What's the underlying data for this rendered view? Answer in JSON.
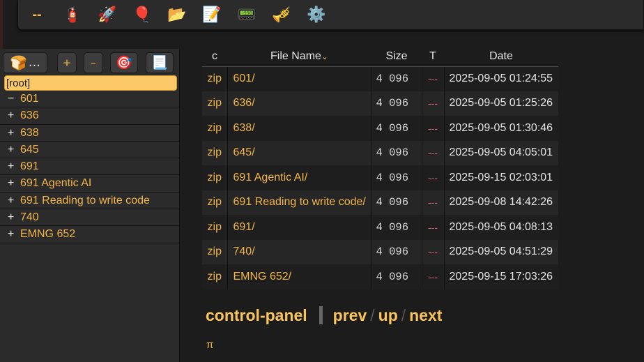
{
  "toolbar": {
    "items": [
      {
        "name": "dashes",
        "glyph": "--"
      },
      {
        "name": "fire-extinguisher-icon",
        "glyph": "🧯"
      },
      {
        "name": "rocket-icon",
        "glyph": "🚀"
      },
      {
        "name": "balloon-icon",
        "glyph": "🎈"
      },
      {
        "name": "open-folder-icon",
        "glyph": "📂"
      },
      {
        "name": "memo-icon",
        "glyph": "📝"
      },
      {
        "name": "pager-icon",
        "glyph": "📟"
      },
      {
        "name": "trumpet-icon",
        "glyph": "🎺"
      },
      {
        "name": "gear-icon",
        "glyph": "⚙️"
      }
    ]
  },
  "sidebar": {
    "home_glyph": "🍞",
    "home_dots": "...",
    "plus": "+",
    "minus": "–",
    "target_glyph": "🎯",
    "doc_glyph": "📃",
    "root_label": "[root]",
    "items": [
      {
        "sign": "−",
        "label": "601"
      },
      {
        "sign": "+",
        "label": "636"
      },
      {
        "sign": "+",
        "label": "638"
      },
      {
        "sign": "+",
        "label": "645"
      },
      {
        "sign": "+",
        "label": "691"
      },
      {
        "sign": "+",
        "label": "691 Agentic AI"
      },
      {
        "sign": "+",
        "label": "691 Reading to write code"
      },
      {
        "sign": "+",
        "label": "740"
      },
      {
        "sign": "+",
        "label": "EMNG 652"
      }
    ]
  },
  "table": {
    "headers": {
      "c": "c",
      "name": "File Name",
      "sort": "⌄",
      "size": "Size",
      "t": "T",
      "date": "Date"
    },
    "rows": [
      {
        "c": "zip",
        "name": "601/",
        "size": "4 096",
        "t": "---",
        "date": "2025-09-05 01:24:55"
      },
      {
        "c": "zip",
        "name": "636/",
        "size": "4 096",
        "t": "---",
        "date": "2025-09-05 01:25:26"
      },
      {
        "c": "zip",
        "name": "638/",
        "size": "4 096",
        "t": "---",
        "date": "2025-09-05 01:30:46"
      },
      {
        "c": "zip",
        "name": "645/",
        "size": "4 096",
        "t": "---",
        "date": "2025-09-05 04:05:01"
      },
      {
        "c": "zip",
        "name": "691 Agentic AI/",
        "size": "4 096",
        "t": "---",
        "date": "2025-09-15 02:03:01"
      },
      {
        "c": "zip",
        "name": "691 Reading to write code/",
        "size": "4 096",
        "t": "---",
        "date": "2025-09-08 14:42:26"
      },
      {
        "c": "zip",
        "name": "691/",
        "size": "4 096",
        "t": "---",
        "date": "2025-09-05 04:08:13"
      },
      {
        "c": "zip",
        "name": "740/",
        "size": "4 096",
        "t": "---",
        "date": "2025-09-05 04:51:29"
      },
      {
        "c": "zip",
        "name": "EMNG 652/",
        "size": "4 096",
        "t": "---",
        "date": "2025-09-15 17:03:26"
      }
    ]
  },
  "nav": {
    "control_panel": "control-panel",
    "prev": "prev",
    "slash": "/",
    "up": "up",
    "next": "next"
  },
  "footer": {
    "pi": "π"
  },
  "colors": {
    "accent": "#f4b64a",
    "root_highlight": "#fbc967",
    "t_column": "#e0667a"
  }
}
